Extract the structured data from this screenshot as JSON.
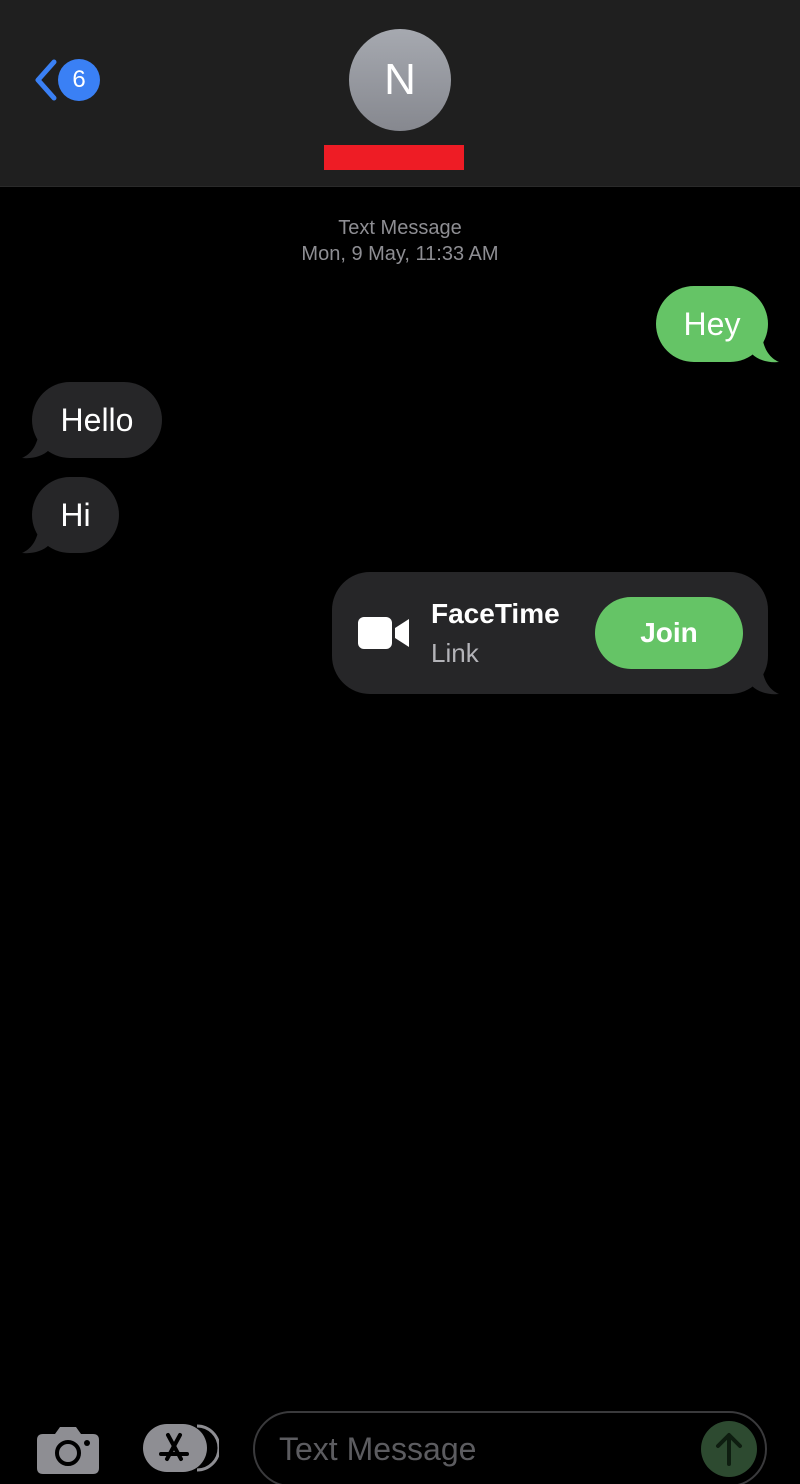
{
  "header": {
    "back_badge": "6",
    "avatar_initial": "N"
  },
  "timestamp": {
    "service": "Text Message",
    "datetime": "Mon, 9 May, 11:33 AM"
  },
  "messages": [
    {
      "direction": "outgoing",
      "text": "Hey"
    },
    {
      "direction": "incoming",
      "text": "Hello"
    },
    {
      "direction": "incoming",
      "text": "Hi"
    }
  ],
  "facetime": {
    "title": "FaceTime",
    "subtitle": "Link",
    "join_label": "Join"
  },
  "compose": {
    "placeholder": "Text Message"
  },
  "colors": {
    "accent_blue": "#3a80f5",
    "bubble_green": "#65c466",
    "bubble_gray": "#262628",
    "redaction_red": "#ee1c25"
  },
  "icons": {
    "back": "chevron-left-icon",
    "camera": "camera-icon",
    "apps": "app-store-icon",
    "send": "arrow-up-icon",
    "video": "video-camera-icon"
  }
}
